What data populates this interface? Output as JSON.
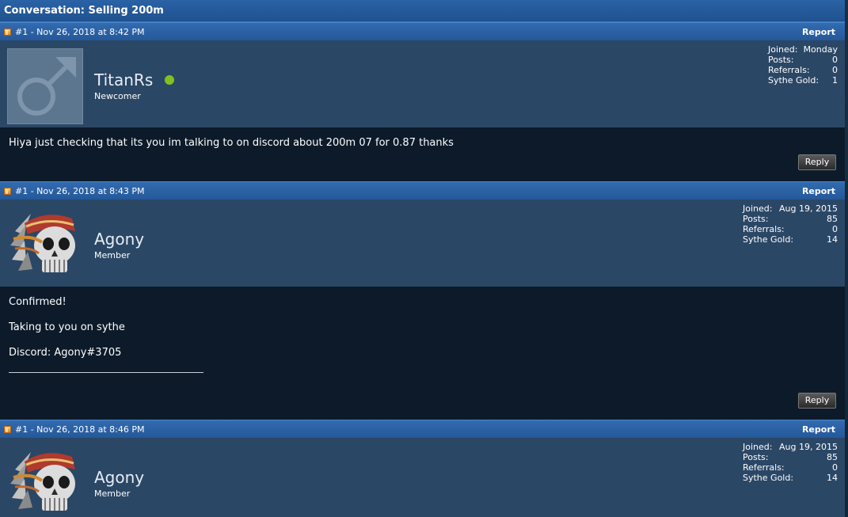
{
  "conversation": {
    "title": "Conversation: Selling 200m"
  },
  "posts": [
    {
      "header": "#1 - Nov 26, 2018 at 8:42 PM",
      "report": "Report",
      "author": {
        "name": "TitanRs",
        "rank": "Newcomer",
        "online": true,
        "avatar": "default-male-avatar"
      },
      "stats": [
        {
          "label": "Joined:",
          "value": "Monday"
        },
        {
          "label": "Posts:",
          "value": "0"
        },
        {
          "label": "Referrals:",
          "value": "0"
        },
        {
          "label": "Sythe Gold:",
          "value": "1"
        }
      ],
      "body": [
        "Hiya just checking that its you im talking to on discord about 200m 07 for 0.87 thanks"
      ],
      "reply": "Reply"
    },
    {
      "header": "#1 - Nov 26, 2018 at 8:43 PM",
      "report": "Report",
      "author": {
        "name": "Agony",
        "rank": "Member",
        "online": false,
        "avatar": "skull-avatar"
      },
      "stats": [
        {
          "label": "Joined:",
          "value": "Aug 19, 2015"
        },
        {
          "label": "Posts:",
          "value": "85"
        },
        {
          "label": "Referrals:",
          "value": "0"
        },
        {
          "label": "Sythe Gold:",
          "value": "14"
        }
      ],
      "body": [
        "Confirmed!",
        "Taking to you on sythe",
        "Discord: Agony#3705"
      ],
      "reply": "Reply"
    },
    {
      "header": "#1 - Nov 26, 2018 at 8:46 PM",
      "report": "Report",
      "author": {
        "name": "Agony",
        "rank": "Member",
        "online": false,
        "avatar": "skull-avatar"
      },
      "stats": [
        {
          "label": "Joined:",
          "value": "Aug 19, 2015"
        },
        {
          "label": "Posts:",
          "value": "85"
        },
        {
          "label": "Referrals:",
          "value": "0"
        },
        {
          "label": "Sythe Gold:",
          "value": "14"
        }
      ]
    }
  ],
  "colors": {
    "header_blue": "#2a62a6",
    "author_bar": "#2b4766",
    "body_bg": "#0c1a2a",
    "online": "#7ec21e"
  }
}
